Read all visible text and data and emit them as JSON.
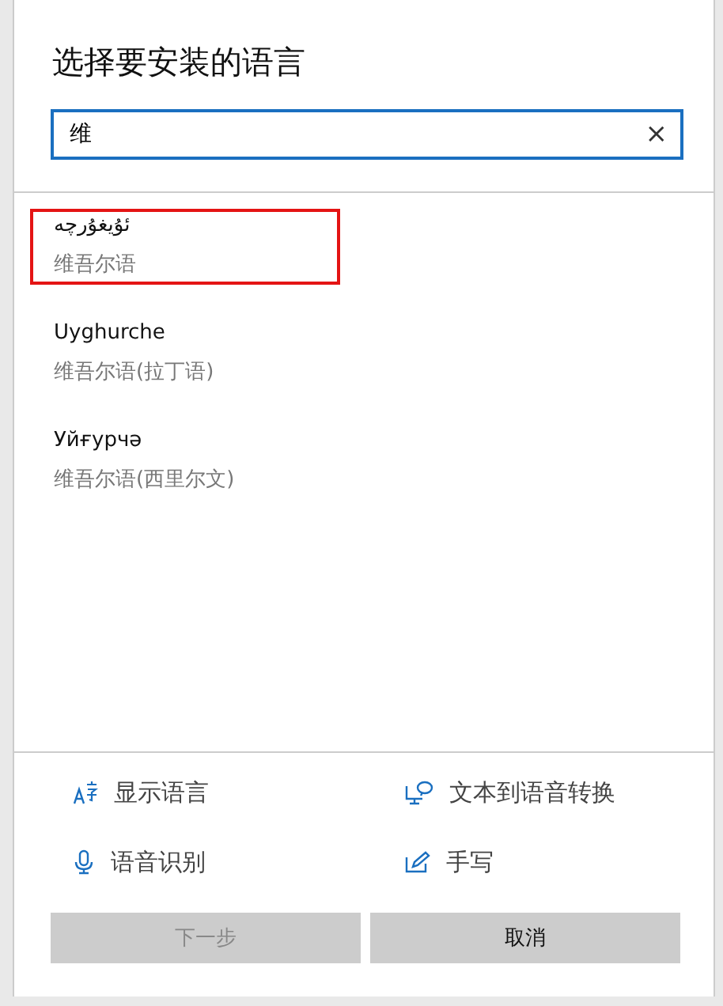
{
  "dialog": {
    "title": "选择要安装的语言"
  },
  "search": {
    "value": "维",
    "clear": "×"
  },
  "languages": [
    {
      "name": "ئۇيغۇرچە",
      "description": "维吾尔语",
      "highlighted": true
    },
    {
      "name": "Uyghurche",
      "description": "维吾尔语(拉丁语)",
      "highlighted": false
    },
    {
      "name": "Уйғурчә",
      "description": "维吾尔语(西里尔文)",
      "highlighted": false
    }
  ],
  "features": [
    {
      "kind": "display",
      "label": "显示语言"
    },
    {
      "kind": "tts",
      "label": "文本到语音转换"
    },
    {
      "kind": "speech",
      "label": "语音识别"
    },
    {
      "kind": "handwriting",
      "label": "手写"
    }
  ],
  "buttons": [
    {
      "label": "下一步",
      "disabled": true
    },
    {
      "label": "取消",
      "disabled": false
    }
  ]
}
